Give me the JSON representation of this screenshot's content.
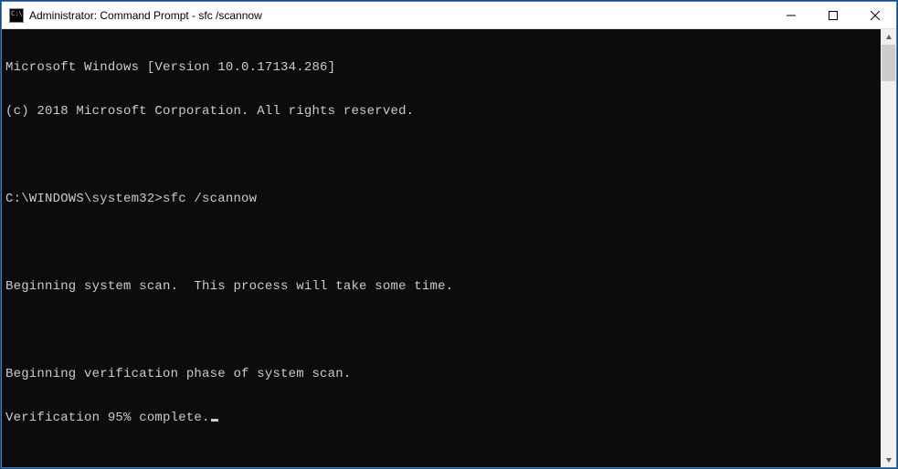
{
  "titlebar": {
    "text": "Administrator: Command Prompt - sfc  /scannow"
  },
  "terminal": {
    "lines": [
      "Microsoft Windows [Version 10.0.17134.286]",
      "(c) 2018 Microsoft Corporation. All rights reserved.",
      "",
      "C:\\WINDOWS\\system32>sfc /scannow",
      "",
      "Beginning system scan.  This process will take some time.",
      "",
      "Beginning verification phase of system scan.",
      "Verification 95% complete."
    ]
  }
}
